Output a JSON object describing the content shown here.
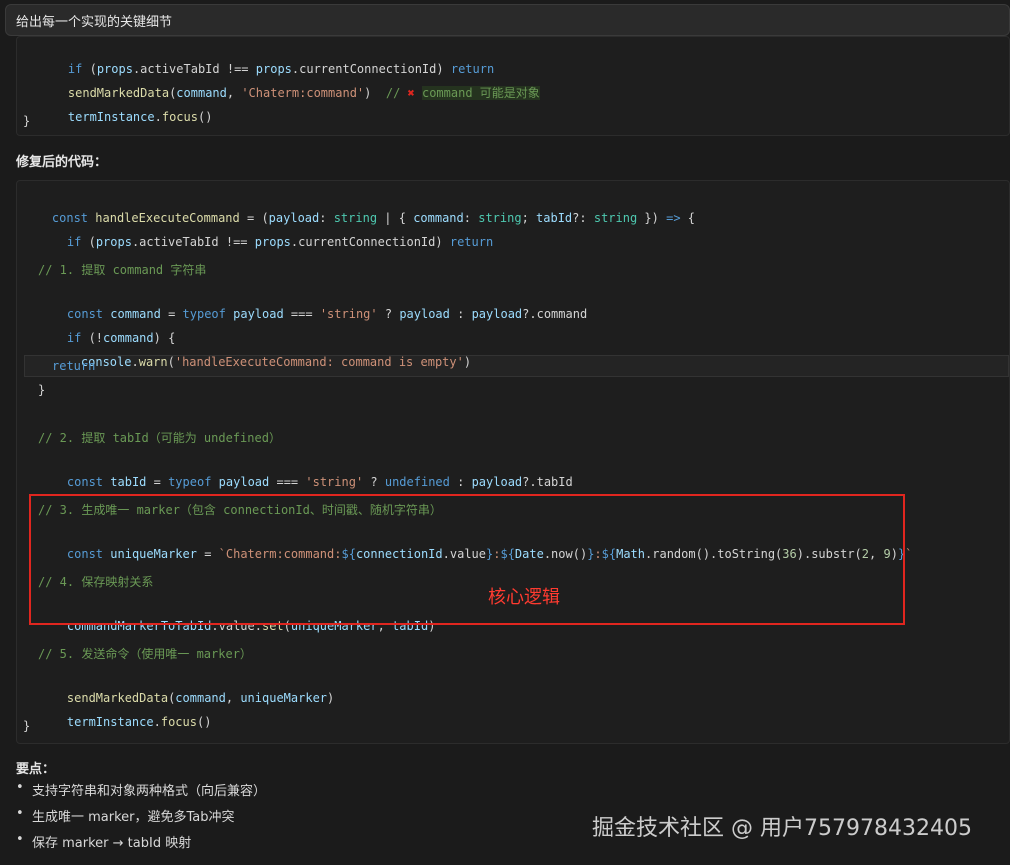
{
  "prompt": "给出每一个实现的关键细节",
  "old_code": {
    "line1": {
      "kw": "if",
      "a": " (",
      "b": "props",
      "c": ".activeTabId !== ",
      "d": "props",
      "e": ".currentConnectionId) ",
      "f": "return"
    },
    "line2": {
      "fn": "sendMarkedData",
      "a": "(",
      "b": "command",
      "c": ", ",
      "d": "'Chaterm:command'",
      "e": ")  ",
      "f": "// ",
      "g": "command 可能是对象"
    },
    "line3": {
      "a": "termInstance",
      "b": ".",
      "c": "focus",
      "d": "()"
    },
    "line4": "}"
  },
  "fixed_heading": "修复后的代码：",
  "fixed_code": {
    "l1": {
      "a": "const ",
      "b": "handleExecuteCommand",
      "c": " = (",
      "d": "payload",
      "e": ": ",
      "f": "string",
      "g": " | { ",
      "h": "command",
      "i": ": ",
      "j": "string",
      "k": "; ",
      "l": "tabId",
      "m": "?: ",
      "n": "string",
      "o": " }) ",
      "p": "=>",
      "q": " {"
    },
    "l2": {
      "a": "if",
      "b": " (",
      "c": "props",
      "d": ".activeTabId !== ",
      "e": "props",
      "f": ".currentConnectionId) ",
      "g": "return"
    },
    "l3": "// 1. 提取 command 字符串",
    "l4": {
      "a": "const ",
      "b": "command",
      "c": " = ",
      "d": "typeof",
      "e": " ",
      "f": "payload",
      "g": " === ",
      "h": "'string'",
      "i": " ? ",
      "j": "payload",
      "k": " : ",
      "l": "payload",
      "m": "?.command"
    },
    "l5": {
      "a": "if",
      "b": " (!",
      "c": "command",
      "d": ") {"
    },
    "l6": {
      "a": "console",
      "b": ".",
      "c": "warn",
      "d": "(",
      "e": "'handleExecuteCommand: command is empty'",
      "f": ")"
    },
    "l7": "return",
    "l8": "}",
    "l9": "// 2. 提取 tabId（可能为 undefined）",
    "l10": {
      "a": "const ",
      "b": "tabId",
      "c": " = ",
      "d": "typeof",
      "e": " ",
      "f": "payload",
      "g": " === ",
      "h": "'string'",
      "i": " ? ",
      "j": "undefined",
      "k": " : ",
      "l": "payload",
      "m": "?.tabId"
    },
    "l11": "// 3. 生成唯一 marker（包含 connectionId、时间戳、随机字符串）",
    "l12": {
      "a": "const ",
      "b": "uniqueMarker",
      "c": " = ",
      "d": "`Chaterm:command:",
      "e": "${",
      "f": "connectionId",
      "g": ".value",
      "h": "}",
      "i": ":",
      "j": "${",
      "k": "Date",
      "l": ".now()",
      "m": "}",
      "n": ":",
      "o": "${",
      "p": "Math",
      "q": ".random().toString(",
      "r": "36",
      "s": ").substr(",
      "t": "2",
      "u": ", ",
      "v": "9",
      "w": ")",
      "x": "}",
      "y": "`"
    },
    "l13": "// 4. 保存映射关系",
    "l14": {
      "a": "commandMarkerToTabId",
      "b": ".value.",
      "c": "set",
      "d": "(",
      "e": "uniqueMarker",
      "f": ", ",
      "g": "tabId",
      "h": ")"
    },
    "l15": "// 5. 发送命令（使用唯一 marker）",
    "l16": {
      "a": "sendMarkedData",
      "b": "(",
      "c": "command",
      "d": ", ",
      "e": "uniqueMarker",
      "f": ")"
    },
    "l17": {
      "a": "termInstance",
      "b": ".",
      "c": "focus",
      "d": "()"
    },
    "l18": "}"
  },
  "core_label": "核心逻辑",
  "points_heading": "要点：",
  "points": [
    "支持字符串和对象两种格式（向后兼容）",
    "生成唯一 marker，避免多Tab冲突",
    "保存 marker → tabId 映射"
  ],
  "watermark": "掘金技术社区 @ 用户757978432405",
  "colors": {
    "highlight_box": "#e0261f",
    "core_label": "#ff3b30",
    "background": "#1b1b1b"
  }
}
